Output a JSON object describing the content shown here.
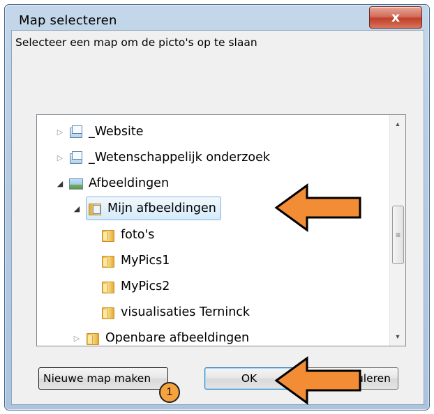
{
  "window": {
    "title": "Map selecteren",
    "close_label": "x"
  },
  "description": "Selecteer een map om de picto's op te slaan",
  "tree": {
    "items": [
      {
        "label": "_Website",
        "icon": "library-icon",
        "expander": "collapsed"
      },
      {
        "label": "_Wetenschappelijk onderzoek",
        "icon": "library-icon",
        "expander": "collapsed"
      },
      {
        "label": "Afbeeldingen",
        "icon": "pictures-library-icon",
        "expander": "expanded"
      },
      {
        "label": "Mijn afbeeldingen",
        "icon": "folder-icon",
        "expander": "expanded",
        "selected": true
      },
      {
        "label": "foto's",
        "icon": "folder-icon"
      },
      {
        "label": "MyPics1",
        "icon": "folder-icon"
      },
      {
        "label": "MyPics2",
        "icon": "folder-icon"
      },
      {
        "label": "visualisaties Terninck",
        "icon": "folder-icon"
      },
      {
        "label": "Openbare afbeeldingen",
        "icon": "folder-icon",
        "expander": "collapsed"
      }
    ]
  },
  "buttons": {
    "new_folder": "Nieuwe map maken",
    "ok": "OK",
    "cancel": "Annuleren"
  },
  "annotation": {
    "badge_number": "1",
    "arrow_color": "#f28c35",
    "badge_color": "#f7a33d"
  },
  "colors": {
    "window_frame": "#b7cce3",
    "close_button": "#c0402a",
    "selection": "#d5ebfb"
  }
}
